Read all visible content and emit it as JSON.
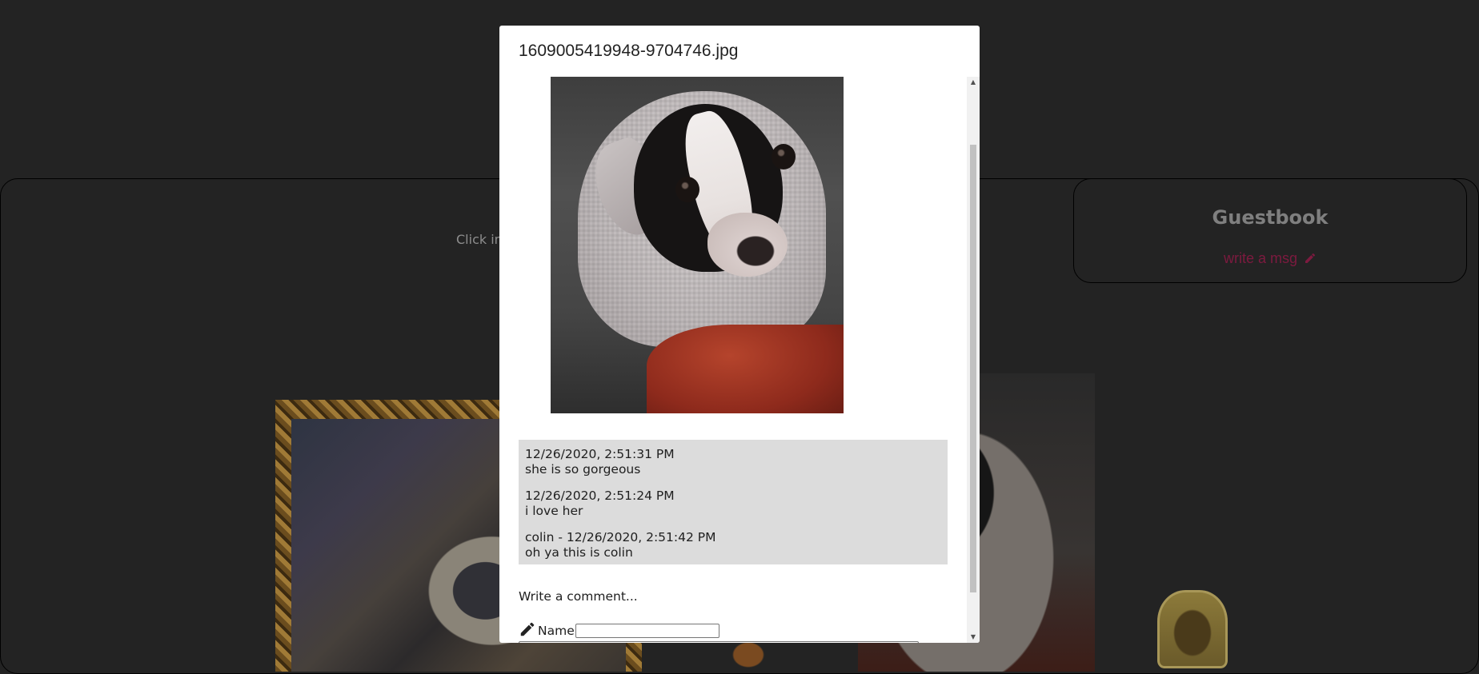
{
  "background": {
    "hint_text": "Click im",
    "guestbook": {
      "title": "Guestbook",
      "write_link": "write a msg"
    }
  },
  "modal": {
    "title": "1609005419948-9704746.jpg",
    "comments": [
      {
        "header": "12/26/2020, 2:51:31 PM",
        "text": "she is so gorgeous"
      },
      {
        "header": "12/26/2020, 2:51:24 PM",
        "text": "i love her"
      },
      {
        "header": "colin - 12/26/2020, 2:51:42 PM",
        "text": "oh ya this is colin"
      }
    ],
    "write_comment_label": "Write a comment...",
    "name_label": "Name",
    "name_value": "",
    "comment_value": ""
  },
  "colors": {
    "page_bg": "#232323",
    "link": "#7d1a3f",
    "comment_bg": "#dcdcdc"
  },
  "icons": [
    "pencil-icon",
    "scroll-up-arrow-icon",
    "scroll-down-arrow-icon"
  ]
}
